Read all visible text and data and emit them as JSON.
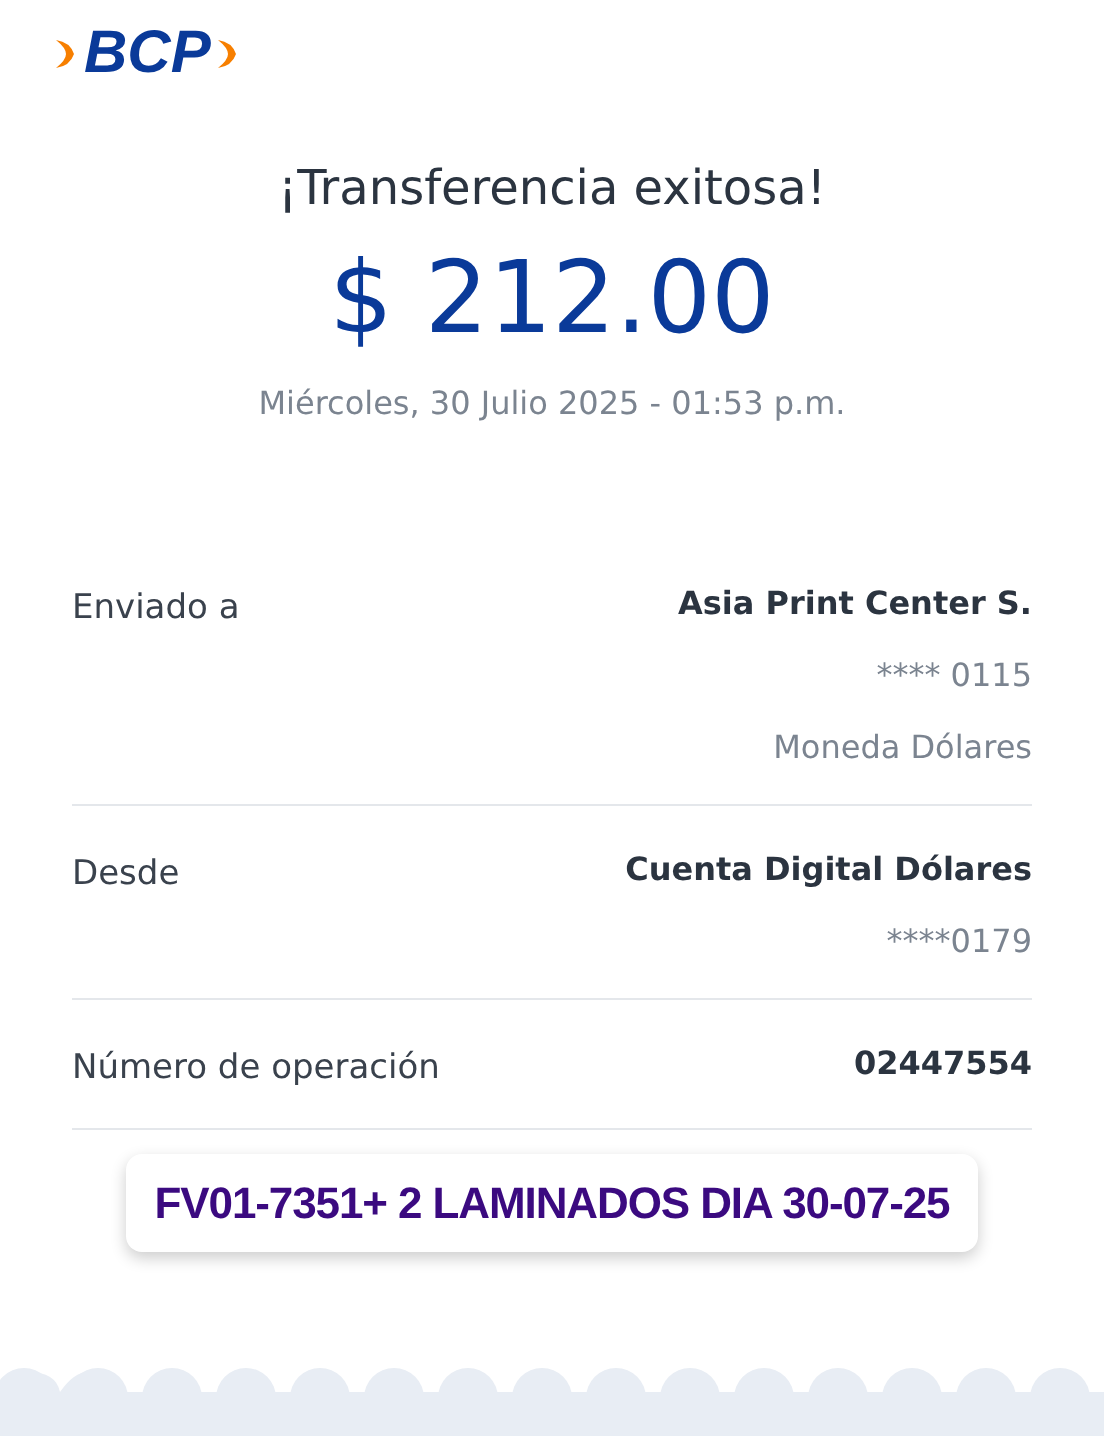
{
  "logo": {
    "text": "BCP"
  },
  "title": "¡Transferencia exitosa!",
  "amount": "$ 212.00",
  "date": "Miércoles, 30 Julio 2025 - 01:53 p.m.",
  "details": [
    {
      "label": "Enviado a",
      "values": [
        "Asia Print Center S.",
        "**** 0115",
        "Moneda Dólares"
      ]
    },
    {
      "label": "Desde",
      "values": [
        "Cuenta Digital Dólares",
        "****0179"
      ]
    },
    {
      "label": "Número de operación",
      "values": [
        "02447554"
      ]
    }
  ],
  "note": "FV01-7351+ 2 LAMINADOS DIA 30-07-25"
}
